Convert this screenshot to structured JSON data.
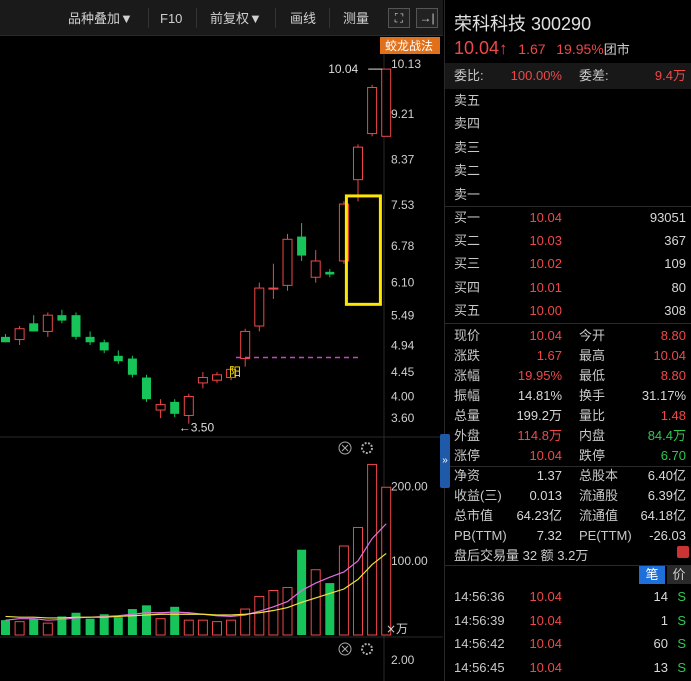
{
  "toolbar": {
    "overlay": "品种叠加▼",
    "f10": "F10",
    "adjust": "前复权▼",
    "draw": "画线",
    "measure": "测量",
    "fullscreen_icon": "expand-icon",
    "collapse_icon": "arrow-right-bar-icon"
  },
  "chart": {
    "tag": "蛟龙战法",
    "price_axis": [
      "10.13",
      "9.21",
      "8.37",
      "7.53",
      "6.78",
      "6.10",
      "5.49",
      "4.94",
      "4.45",
      "4.00",
      "3.60"
    ],
    "high_label": "10.04",
    "low_label": "3.50",
    "yang_label": "阳",
    "volume_axis": [
      "200.00",
      "100.00"
    ],
    "volume_unit": "×万",
    "bottom_axis": "2.00"
  },
  "chart_data": {
    "type": "candlestick",
    "candles": [
      {
        "o": 5.1,
        "h": 5.15,
        "l": 5.0,
        "c": 5.0,
        "v": 20
      },
      {
        "o": 5.05,
        "h": 5.3,
        "l": 4.95,
        "c": 5.25,
        "v": 18
      },
      {
        "o": 5.35,
        "h": 5.5,
        "l": 5.2,
        "c": 5.2,
        "v": 22
      },
      {
        "o": 5.2,
        "h": 5.55,
        "l": 5.1,
        "c": 5.5,
        "v": 16
      },
      {
        "o": 5.5,
        "h": 5.6,
        "l": 5.35,
        "c": 5.4,
        "v": 25
      },
      {
        "o": 5.5,
        "h": 5.55,
        "l": 5.05,
        "c": 5.1,
        "v": 30
      },
      {
        "o": 5.1,
        "h": 5.2,
        "l": 4.95,
        "c": 5.0,
        "v": 22
      },
      {
        "o": 5.0,
        "h": 5.05,
        "l": 4.8,
        "c": 4.85,
        "v": 28
      },
      {
        "o": 4.75,
        "h": 4.85,
        "l": 4.6,
        "c": 4.65,
        "v": 24
      },
      {
        "o": 4.7,
        "h": 4.75,
        "l": 4.35,
        "c": 4.4,
        "v": 35
      },
      {
        "o": 4.35,
        "h": 4.4,
        "l": 3.9,
        "c": 3.95,
        "v": 40
      },
      {
        "o": 3.75,
        "h": 3.95,
        "l": 3.6,
        "c": 3.85,
        "v": 22
      },
      {
        "o": 3.9,
        "h": 3.95,
        "l": 3.62,
        "c": 3.68,
        "v": 38
      },
      {
        "o": 3.65,
        "h": 4.05,
        "l": 3.5,
        "c": 4.0,
        "v": 20
      },
      {
        "o": 4.25,
        "h": 4.45,
        "l": 4.15,
        "c": 4.35,
        "v": 20
      },
      {
        "o": 4.3,
        "h": 4.45,
        "l": 4.25,
        "c": 4.4,
        "v": 18
      },
      {
        "o": 4.35,
        "h": 4.55,
        "l": 4.3,
        "c": 4.5,
        "v": 20
      },
      {
        "o": 4.7,
        "h": 5.25,
        "l": 4.55,
        "c": 5.2,
        "v": 35
      },
      {
        "o": 5.3,
        "h": 6.1,
        "l": 5.2,
        "c": 6.0,
        "v": 52
      },
      {
        "o": 6.0,
        "h": 6.45,
        "l": 5.8,
        "c": 6.0,
        "v": 60
      },
      {
        "o": 6.05,
        "h": 7.0,
        "l": 5.95,
        "c": 6.9,
        "v": 64
      },
      {
        "o": 6.95,
        "h": 7.2,
        "l": 6.5,
        "c": 6.6,
        "v": 115
      },
      {
        "o": 6.2,
        "h": 6.7,
        "l": 6.1,
        "c": 6.5,
        "v": 88
      },
      {
        "o": 6.3,
        "h": 6.35,
        "l": 6.2,
        "c": 6.25,
        "v": 70
      },
      {
        "o": 6.5,
        "h": 7.6,
        "l": 6.45,
        "c": 7.55,
        "v": 120
      },
      {
        "o": 8.0,
        "h": 8.65,
        "l": 7.6,
        "c": 8.6,
        "v": 145
      },
      {
        "o": 8.85,
        "h": 9.75,
        "l": 8.8,
        "c": 9.7,
        "v": 230
      },
      {
        "o": 8.8,
        "h": 10.04,
        "l": 8.8,
        "c": 10.04,
        "v": 199.2
      }
    ],
    "price_range": [
      3.4,
      10.3
    ],
    "volume_max": 240,
    "ma_volume": [
      [
        20,
        22,
        22,
        20,
        21,
        23,
        24,
        25,
        26,
        28,
        30,
        30,
        31,
        30,
        28,
        26,
        25,
        27,
        32,
        38,
        45,
        60,
        70,
        78,
        85,
        100,
        130,
        150
      ],
      [
        25,
        24,
        24,
        23,
        23,
        24,
        24,
        24,
        25,
        26,
        27,
        28,
        28,
        28,
        28,
        27,
        27,
        28,
        30,
        33,
        37,
        44,
        50,
        56,
        62,
        75,
        95,
        110
      ]
    ]
  },
  "panel": {
    "stock_name": "荣科科技",
    "stock_code": "300290",
    "price": "10.04",
    "price_arrow": "↑",
    "change": "1.67",
    "change_pct": "19.95%",
    "market": "团市",
    "weibi_label": "委比:",
    "weibi_value": "100.00%",
    "weicha_label": "委差:",
    "weicha_value": "9.4万",
    "asks": [
      {
        "label": "卖五",
        "price": "",
        "vol": ""
      },
      {
        "label": "卖四",
        "price": "",
        "vol": ""
      },
      {
        "label": "卖三",
        "price": "",
        "vol": ""
      },
      {
        "label": "卖二",
        "price": "",
        "vol": ""
      },
      {
        "label": "卖一",
        "price": "",
        "vol": ""
      }
    ],
    "bids": [
      {
        "label": "买一",
        "price": "10.04",
        "vol": "93051"
      },
      {
        "label": "买二",
        "price": "10.03",
        "vol": "367"
      },
      {
        "label": "买三",
        "price": "10.02",
        "vol": "109"
      },
      {
        "label": "买四",
        "price": "10.01",
        "vol": "80"
      },
      {
        "label": "买五",
        "price": "10.00",
        "vol": "308"
      }
    ],
    "stats": [
      {
        "l1": "现价",
        "v1": "10.04",
        "c1": "red",
        "l2": "今开",
        "v2": "8.80",
        "c2": "red"
      },
      {
        "l1": "涨跌",
        "v1": "1.67",
        "c1": "red",
        "l2": "最高",
        "v2": "10.04",
        "c2": "red"
      },
      {
        "l1": "涨幅",
        "v1": "19.95%",
        "c1": "red",
        "l2": "最低",
        "v2": "8.80",
        "c2": "red"
      },
      {
        "l1": "振幅",
        "v1": "14.81%",
        "c1": "white",
        "l2": "换手",
        "v2": "31.17%",
        "c2": "white"
      },
      {
        "l1": "总量",
        "v1": "199.2万",
        "c1": "white",
        "l2": "量比",
        "v2": "1.48",
        "c2": "red"
      },
      {
        "l1": "外盘",
        "v1": "114.8万",
        "c1": "red",
        "l2": "内盘",
        "v2": "84.4万",
        "c2": "green"
      },
      {
        "l1": "涨停",
        "v1": "10.04",
        "c1": "red",
        "l2": "跌停",
        "v2": "6.70",
        "c2": "green"
      }
    ],
    "fin": [
      {
        "l1": "净资",
        "v1": "1.37",
        "l2": "总股本",
        "v2": "6.40亿"
      },
      {
        "l1": "收益(三)",
        "v1": "0.013",
        "l2": "流通股",
        "v2": "6.39亿"
      },
      {
        "l1": "总市值",
        "v1": "64.23亿",
        "l2": "流通值",
        "v2": "64.18亿"
      },
      {
        "l1": "PB(TTM)",
        "v1": "7.32",
        "l2": "PE(TTM)",
        "v2": "-26.03"
      }
    ],
    "after_hours": "盘后交易量 32 额 3.2万",
    "tab_active": "笔",
    "tab_price": "价",
    "trades": [
      {
        "time": "14:56:36",
        "price": "10.04",
        "vol": "14",
        "side": "S"
      },
      {
        "time": "14:56:39",
        "price": "10.04",
        "vol": "1",
        "side": "S"
      },
      {
        "time": "14:56:42",
        "price": "10.04",
        "vol": "60",
        "side": "S"
      },
      {
        "time": "14:56:45",
        "price": "10.04",
        "vol": "13",
        "side": "S"
      }
    ]
  }
}
